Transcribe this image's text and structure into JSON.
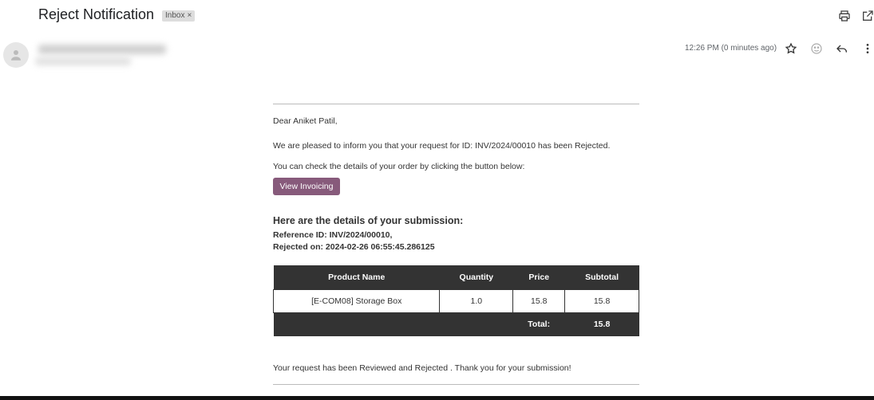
{
  "email": {
    "subject": "Reject Notification",
    "label_chip": "Inbox",
    "label_close": "×",
    "timestamp": "12:26 PM (0 minutes ago)"
  },
  "message": {
    "greeting": "Dear Aniket Patil,",
    "line1": "We are pleased to inform you that your request for ID: INV/2024/00010 has been Rejected.",
    "line2": "You can check the details of your order by clicking the button below:",
    "button_label": "View Invoicing",
    "details_heading": "Here are the details of your submission:",
    "reference": "Reference ID: INV/2024/00010,",
    "rejected_on": "Rejected on: 2024-02-26 06:55:45.286125",
    "footer": "Your request has been Reviewed and Rejected . Thank you for your submission!"
  },
  "table": {
    "headers": [
      "Product Name",
      "Quantity",
      "Price",
      "Subtotal"
    ],
    "rows": [
      {
        "product": "[E-COM08] Storage Box",
        "quantity": "1.0",
        "price": "15.8",
        "subtotal": "15.8"
      }
    ],
    "total_label": "Total:",
    "total_value": "15.8"
  },
  "icons": {
    "print": "print-icon",
    "open_new": "open-in-new-window-icon",
    "avatar": "person-icon",
    "star": "star-icon",
    "emoji": "emoji-reaction-icon",
    "reply": "reply-icon",
    "more": "more-vertical-icon"
  },
  "colors": {
    "button_bg": "#875a7b",
    "table_header_bg": "#333333",
    "chip_bg": "#dddddd"
  }
}
